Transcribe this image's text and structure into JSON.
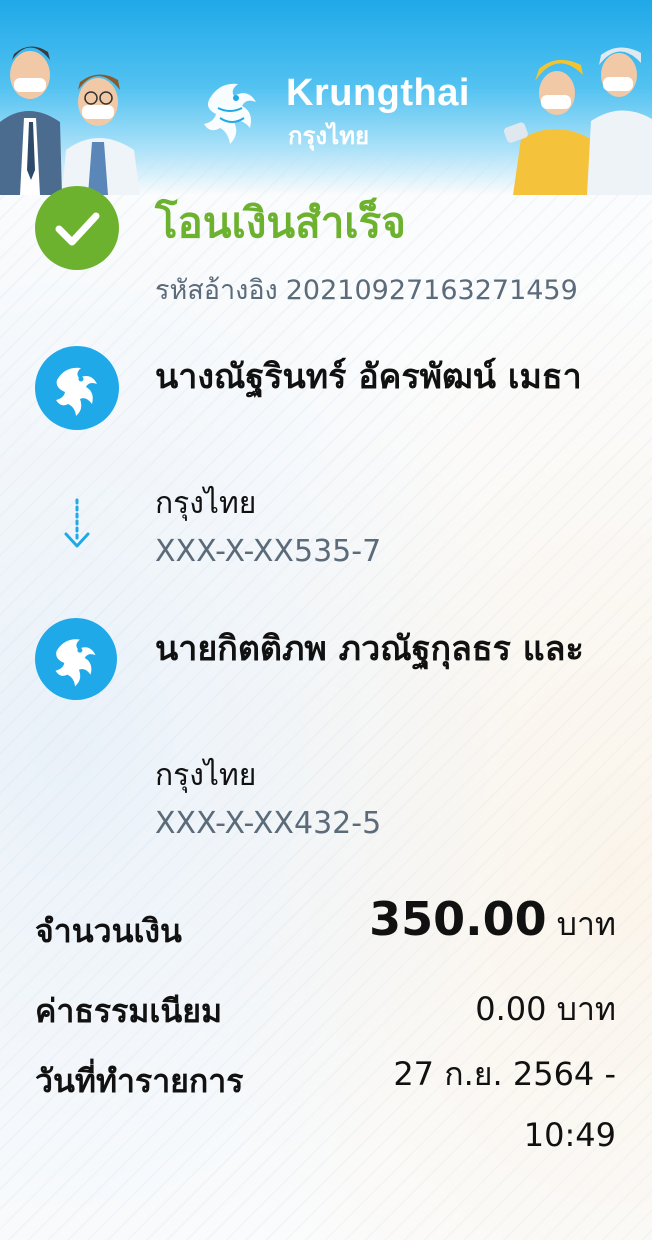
{
  "brand": {
    "name": "Krungthai",
    "name_thai": "กรุงไทย",
    "color": "#1fa9e8"
  },
  "status": {
    "icon": "check-circle-icon",
    "title": "โอนเงินสำเร็จ",
    "color": "#6cb22e",
    "reference_label": "รหัสอ้างอิง",
    "reference_number": "2021092716327145​9"
  },
  "sender": {
    "icon": "krungthai-bank-icon",
    "name": "นางณัฐรินทร์ อัครพัฒน์ เมธา",
    "bank": "กรุงไทย",
    "account": "XXX-X-XX535-7"
  },
  "transfer_arrow_icon": "arrow-down-icon",
  "receiver": {
    "icon": "krungthai-bank-icon",
    "name": "นายกิตติภพ ภวณัฐกุลธร และ",
    "bank": "กรุงไทย",
    "account": "XXX-X-XX432-5"
  },
  "summary": {
    "amount_label": "จำนวนเงิน",
    "amount_value": "350.00",
    "amount_unit": "บาท",
    "fee_label": "ค่าธรรมเนียม",
    "fee_value": "0.00 บาท",
    "date_label": "วันที่ทำรายการ",
    "date_value": "27 ก.ย. 2564 - 10:49"
  }
}
